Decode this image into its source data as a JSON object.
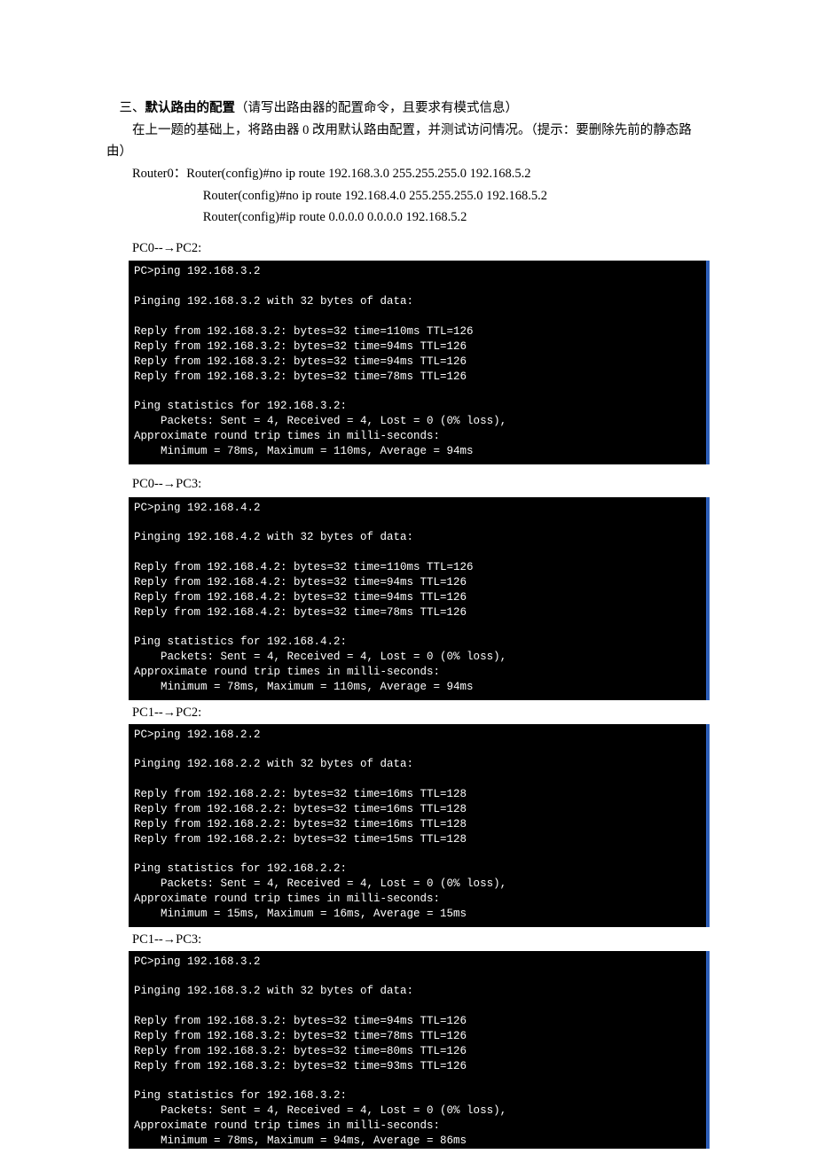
{
  "heading": {
    "prefix": "三、",
    "title": "默认路由的配置",
    "note": "（请写出路由器的配置命令，且要求有模式信息）"
  },
  "intro": "在上一题的基础上，将路由器 0 改用默认路由配置，并测试访问情况。（提示：要删除先前的静态路由）",
  "router": {
    "line1": "Router0：Router(config)#no ip route 192.168.3.0 255.255.255.0 192.168.5.2",
    "line2": "Router(config)#no ip route 192.168.4.0 255.255.255.0 192.168.5.2",
    "line3": "Router(config)#ip route 0.0.0.0 0.0.0.0 192.168.5.2"
  },
  "sections": [
    {
      "label": "PC0--→PC2:",
      "terminal": "PC>ping 192.168.3.2\n\nPinging 192.168.3.2 with 32 bytes of data:\n\nReply from 192.168.3.2: bytes=32 time=110ms TTL=126\nReply from 192.168.3.2: bytes=32 time=94ms TTL=126\nReply from 192.168.3.2: bytes=32 time=94ms TTL=126\nReply from 192.168.3.2: bytes=32 time=78ms TTL=126\n\nPing statistics for 192.168.3.2:\n    Packets: Sent = 4, Received = 4, Lost = 0 (0% loss),\nApproximate round trip times in milli-seconds:\n    Minimum = 78ms, Maximum = 110ms, Average = 94ms"
    },
    {
      "label": "PC0--→PC3:",
      "terminal": "PC>ping 192.168.4.2\n\nPinging 192.168.4.2 with 32 bytes of data:\n\nReply from 192.168.4.2: bytes=32 time=110ms TTL=126\nReply from 192.168.4.2: bytes=32 time=94ms TTL=126\nReply from 192.168.4.2: bytes=32 time=94ms TTL=126\nReply from 192.168.4.2: bytes=32 time=78ms TTL=126\n\nPing statistics for 192.168.4.2:\n    Packets: Sent = 4, Received = 4, Lost = 0 (0% loss),\nApproximate round trip times in milli-seconds:\n    Minimum = 78ms, Maximum = 110ms, Average = 94ms"
    },
    {
      "label": "PC1--→PC2:",
      "terminal": "PC>ping 192.168.2.2\n\nPinging 192.168.2.2 with 32 bytes of data:\n\nReply from 192.168.2.2: bytes=32 time=16ms TTL=128\nReply from 192.168.2.2: bytes=32 time=16ms TTL=128\nReply from 192.168.2.2: bytes=32 time=16ms TTL=128\nReply from 192.168.2.2: bytes=32 time=15ms TTL=128\n\nPing statistics for 192.168.2.2:\n    Packets: Sent = 4, Received = 4, Lost = 0 (0% loss),\nApproximate round trip times in milli-seconds:\n    Minimum = 15ms, Maximum = 16ms, Average = 15ms"
    },
    {
      "label": "PC1--→PC3:",
      "terminal": "PC>ping 192.168.3.2\n\nPinging 192.168.3.2 with 32 bytes of data:\n\nReply from 192.168.3.2: bytes=32 time=94ms TTL=126\nReply from 192.168.3.2: bytes=32 time=78ms TTL=126\nReply from 192.168.3.2: bytes=32 time=80ms TTL=126\nReply from 192.168.3.2: bytes=32 time=93ms TTL=126\n\nPing statistics for 192.168.3.2:\n    Packets: Sent = 4, Received = 4, Lost = 0 (0% loss),\nApproximate round trip times in milli-seconds:\n    Minimum = 78ms, Maximum = 94ms, Average = 86ms"
    }
  ]
}
